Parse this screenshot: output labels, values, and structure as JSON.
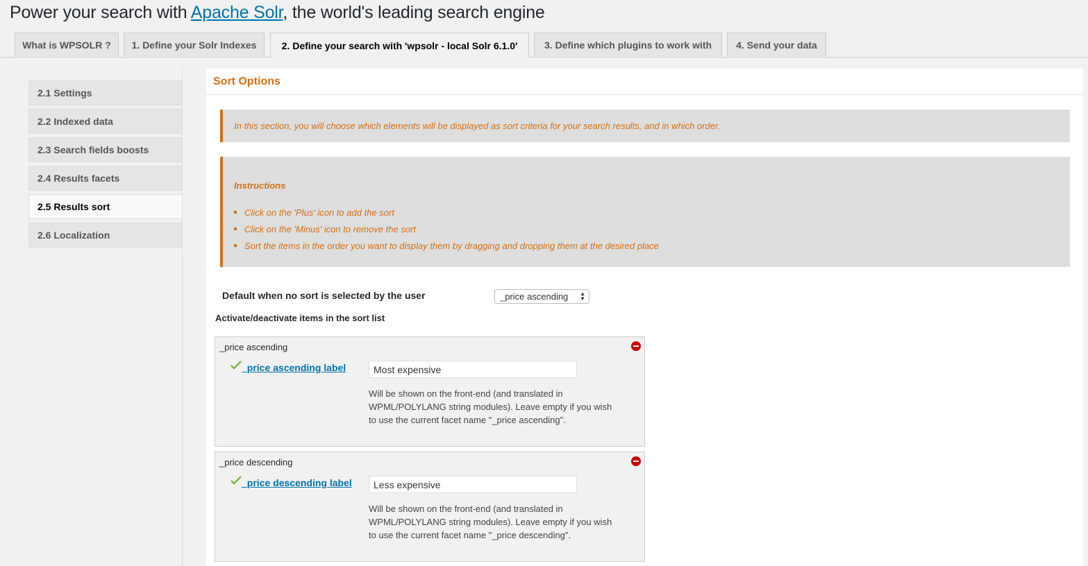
{
  "header": {
    "title_prefix": "Power your search with ",
    "title_link": "Apache Solr",
    "title_suffix": ", the world's leading search engine"
  },
  "tabs": [
    {
      "label": "What is WPSOLR ?"
    },
    {
      "label": "1. Define your Solr Indexes"
    },
    {
      "label": "2. Define your search with 'wpsolr - local Solr 6.1.0'"
    },
    {
      "label": "3. Define which plugins to work with"
    },
    {
      "label": "4. Send your data"
    }
  ],
  "sidebar": {
    "items": [
      {
        "label": "2.1 Settings"
      },
      {
        "label": "2.2 Indexed data"
      },
      {
        "label": "2.3 Search fields boosts"
      },
      {
        "label": "2.4 Results facets"
      },
      {
        "label": "2.5 Results sort"
      },
      {
        "label": "2.6 Localization"
      }
    ]
  },
  "main": {
    "title": "Sort Options",
    "intro": "In this section, you will choose which elements will be displayed as sort criteria for your search results, and in which order.",
    "instructions": {
      "title": "Instructions",
      "items": [
        "Click on the 'Plus' icon to add the sort",
        "Click on the 'Minus' icon to remove the sort",
        "Sort the items in the order you want to display them by dragging and dropping them at the desired place"
      ]
    },
    "default_label": "Default when no sort is selected by the user",
    "default_value": "_price ascending",
    "activate_label": "Activate/deactivate items in the sort list",
    "sort_items": [
      {
        "name": "_price ascending",
        "label_text": "_price ascending label",
        "input_value": "Most expensive",
        "help": "Will be shown on the front-end (and translated in WPML/POLYLANG string modules). Leave empty if you wish to use the current facet name \"_price ascending\"."
      },
      {
        "name": "_price descending",
        "label_text": "_price descending label",
        "input_value": "Less expensive",
        "help": "Will be shown on the front-end (and translated in WPML/POLYLANG string modules). Leave empty if you wish to use the current facet name \"_price descending\"."
      }
    ]
  },
  "colors": {
    "accent_orange": "#d46f15",
    "link_blue": "#0073aa",
    "remove_red": "#cc0000",
    "check_green": "#7ab648"
  }
}
